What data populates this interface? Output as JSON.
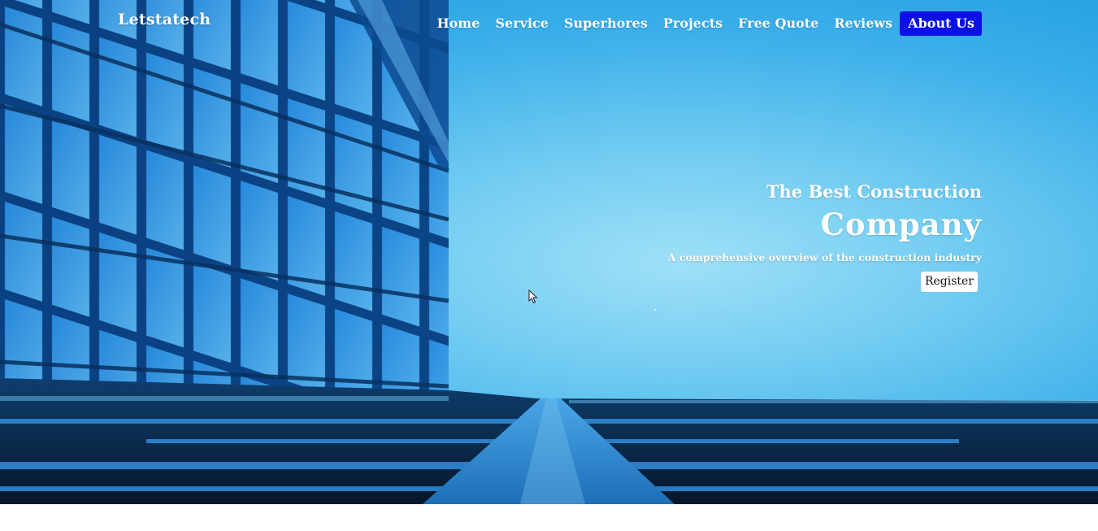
{
  "brand": {
    "name": "Letstatech"
  },
  "nav": {
    "items": [
      {
        "label": "Home",
        "active": false
      },
      {
        "label": "Service",
        "active": false
      },
      {
        "label": "Superhores",
        "active": false
      },
      {
        "label": "Projects",
        "active": false
      },
      {
        "label": "Free Quote",
        "active": false
      },
      {
        "label": "Reviews",
        "active": false
      },
      {
        "label": "About Us",
        "active": true
      }
    ]
  },
  "hero": {
    "tagline": "The Best Construction",
    "headline": "Company",
    "subtitle": "A comprehensive overview of the construction industry",
    "register_label": "Register"
  },
  "colors": {
    "sky_light": "#9fe0f7",
    "sky_dark": "#1799de",
    "active_nav_bg": "#0a10e6",
    "text": "#ffffff"
  },
  "icons": {
    "cursor": "mouse-pointer-icon"
  }
}
